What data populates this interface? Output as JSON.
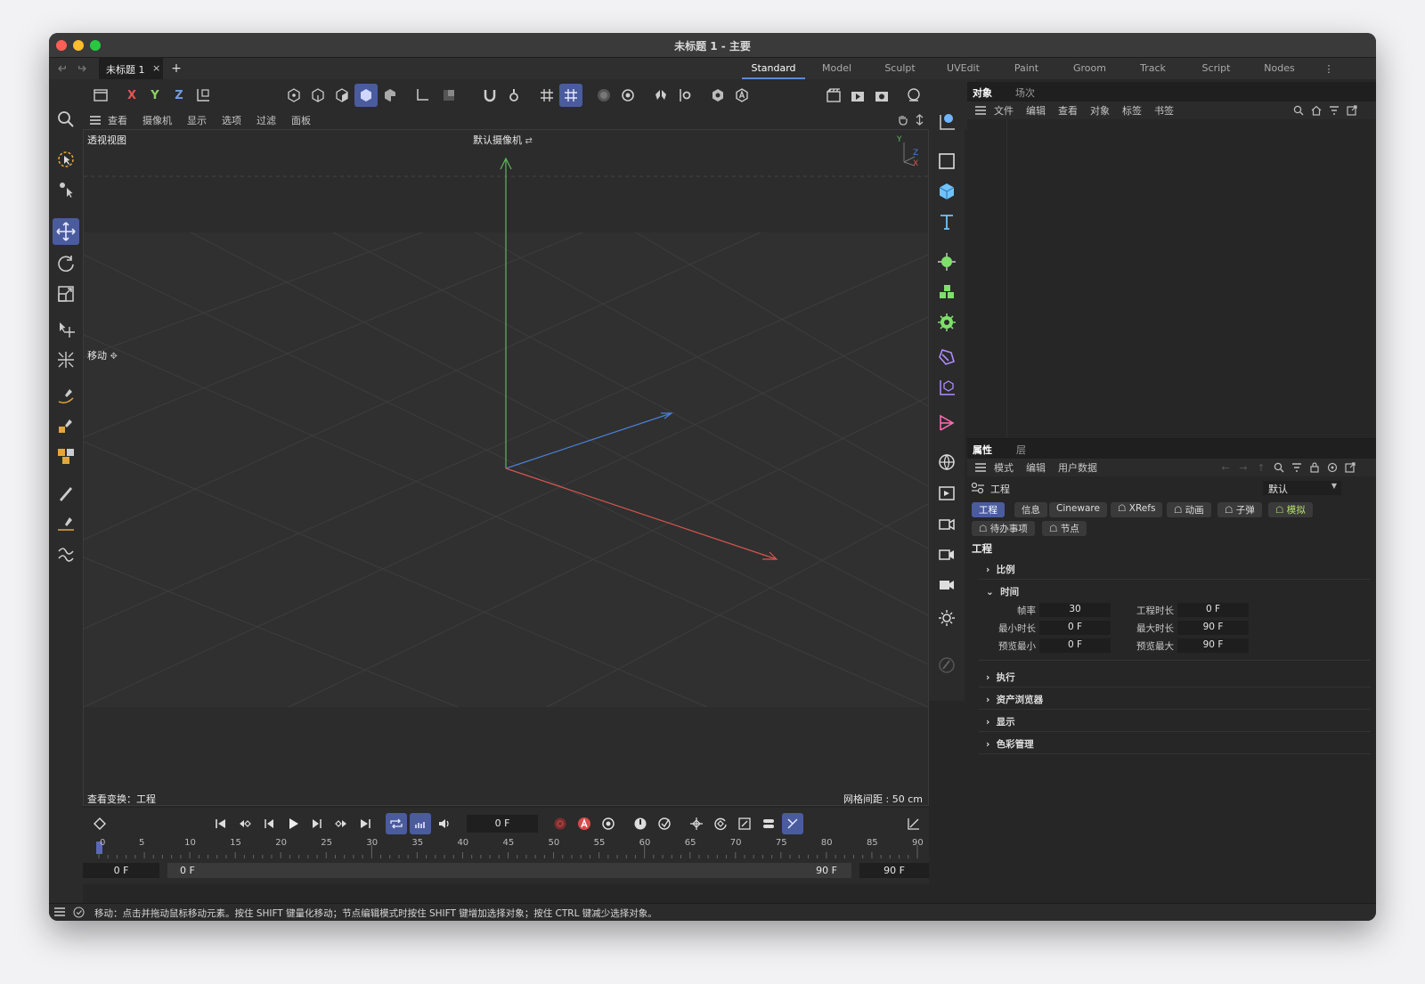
{
  "window": {
    "title": "未标题 1 - 主要"
  },
  "doc_tab": {
    "label": "未标题 1",
    "close": "×",
    "add": "+"
  },
  "layouts": [
    "Standard",
    "Model",
    "Sculpt",
    "UVEdit",
    "Paint",
    "Groom",
    "Track",
    "Script",
    "Nodes"
  ],
  "toolbar": {
    "axis_x": "X",
    "axis_y": "Y",
    "axis_z": "Z"
  },
  "viewport": {
    "menu": [
      "查看",
      "摄像机",
      "显示",
      "选项",
      "过滤",
      "面板"
    ],
    "name": "透视视图",
    "camera": "默认摄像机",
    "tool_hint": "移动",
    "view_transform": "查看变换：工程",
    "grid_spacing": "网格间距 : 50 cm",
    "gizmo": {
      "y": "Y",
      "z": "Z",
      "x": "X"
    }
  },
  "timeline": {
    "current_frame": "0 F",
    "ruler_ticks": [
      "0",
      "5",
      "10",
      "15",
      "20",
      "25",
      "30",
      "35",
      "40",
      "45",
      "50",
      "55",
      "60",
      "65",
      "70",
      "75",
      "80",
      "85",
      "90"
    ],
    "range_start": "0 F",
    "range_min": "0 F",
    "range_max": "90 F",
    "range_end": "90 F"
  },
  "status": {
    "text": "移动：点击并拖动鼠标移动元素。按住 SHIFT 键量化移动；节点编辑模式时按住 SHIFT 键增加选择对象；按住 CTRL 键减少选择对象。"
  },
  "object_panel": {
    "tabs": [
      "对象",
      "场次"
    ],
    "menu": [
      "文件",
      "编辑",
      "查看",
      "对象",
      "标签",
      "书签"
    ]
  },
  "attributes": {
    "tabs": [
      "属性",
      "层"
    ],
    "menu": [
      "模式",
      "编辑",
      "用户数据"
    ],
    "mode_label": "工程",
    "preset": "默认",
    "chips": [
      "工程",
      "信息",
      "Cineware",
      "XRefs",
      "动画",
      "子弹",
      "模拟",
      "待办事项",
      "节点"
    ],
    "section_title": "工程",
    "sections": {
      "scale": "比例",
      "time": "时间",
      "exec": "执行",
      "asset": "资产浏览器",
      "display": "显示",
      "color": "色彩管理"
    },
    "fields": {
      "fps_label": "帧率",
      "fps_value": "30",
      "proj_len_label": "工程时长",
      "proj_len_value": "0 F",
      "min_len_label": "最小时长",
      "min_len_value": "0 F",
      "max_len_label": "最大时长",
      "max_len_value": "90 F",
      "prev_min_label": "预览最小",
      "prev_min_value": "0 F",
      "prev_max_label": "预览最大",
      "prev_max_value": "90 F"
    }
  },
  "colors": {
    "accent": "#4a5c9e",
    "x_axis": "#d9534f",
    "y_axis": "#5cb85c",
    "z_axis": "#4a7fd6",
    "sim_chip": "#b7e36a"
  }
}
